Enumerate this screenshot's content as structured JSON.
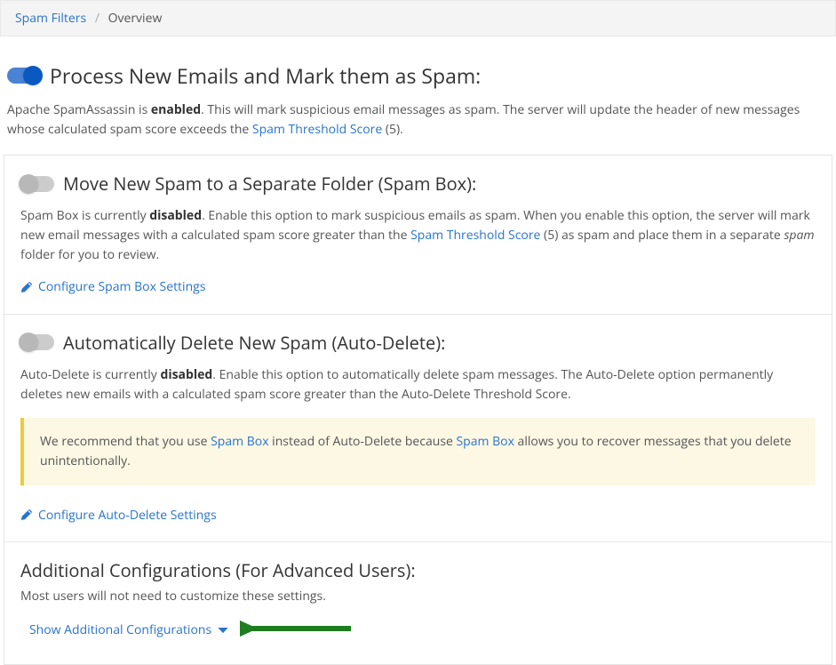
{
  "breadcrumb": {
    "root": "Spam Filters",
    "current": "Overview"
  },
  "process": {
    "title": "Process New Emails and Mark them as Spam:",
    "toggle_on": true,
    "desc_pre": "Apache SpamAssassin is ",
    "desc_bold": "enabled",
    "desc_post": ". This will mark suspicious email messages as spam. The server will update the header of new messages whose calculated spam score exceeds the ",
    "threshold_link": "Spam Threshold Score",
    "threshold_suffix": " (5)."
  },
  "spambox": {
    "title": "Move New Spam to a Separate Folder (Spam Box):",
    "toggle_on": false,
    "desc_pre": "Spam Box is currently ",
    "desc_bold": "disabled",
    "desc_mid": ". Enable this option to mark suspicious emails as spam. When you enable this option, the server will mark new email messages with a calculated spam score greater than the ",
    "threshold_link": "Spam Threshold Score",
    "desc_post_link": " (5) as spam and place them in a separate ",
    "desc_em": "spam",
    "desc_end": " folder for you to review.",
    "configure_label": "Configure Spam Box Settings"
  },
  "autodelete": {
    "title": "Automatically Delete New Spam (Auto-Delete):",
    "toggle_on": false,
    "desc_pre": "Auto-Delete is currently ",
    "desc_bold": "disabled",
    "desc_post": ". Enable this option to automatically delete spam messages. The Auto-Delete option permanently deletes new emails with a calculated spam score greater than the Auto-Delete Threshold Score.",
    "callout_pre": "We recommend that you use ",
    "callout_link1": "Spam Box",
    "callout_mid": " instead of Auto-Delete because ",
    "callout_link2": "Spam Box",
    "callout_post": " allows you to recover messages that you delete unintentionally.",
    "configure_label": "Configure Auto-Delete Settings"
  },
  "advanced": {
    "title": "Additional Configurations (For Advanced Users):",
    "subtitle": "Most users will not need to customize these settings.",
    "show_label": "Show Additional Configurations"
  }
}
